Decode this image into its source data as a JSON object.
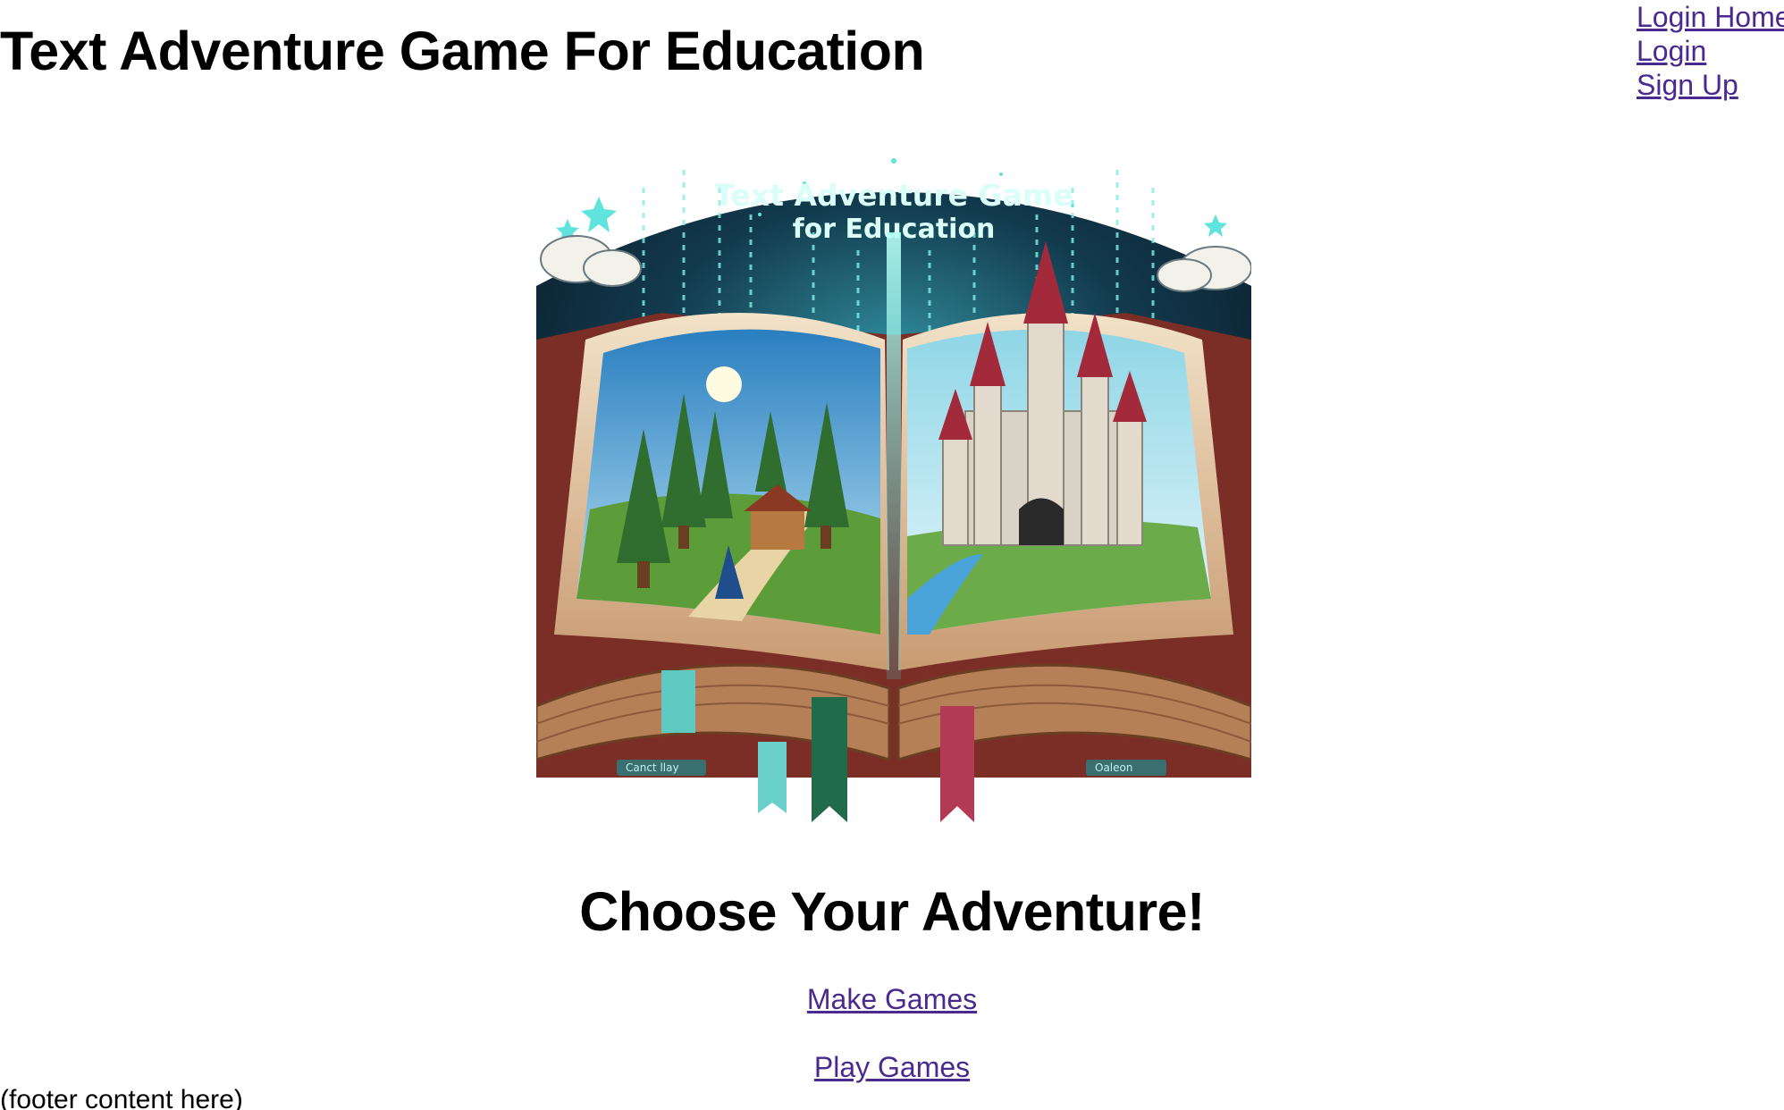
{
  "header": {
    "title": "Text Adventure Game For Education"
  },
  "nav": {
    "login_home": "Login Home",
    "login": "Login",
    "sign_up": "Sign Up"
  },
  "hero": {
    "image_caption_line1": "Text Adventure Game",
    "image_caption_line2": "for Education",
    "tab_label_left": "Canct llay",
    "tab_label_right": "Oaleon"
  },
  "main": {
    "heading": "Choose Your Adventure!",
    "make_games_label": "Make Games",
    "play_games_label": "Play Games"
  },
  "footer": {
    "text": "(footer content here)"
  },
  "colors": {
    "link": "#4b2a8f",
    "text": "#000000",
    "background": "#ffffff"
  }
}
